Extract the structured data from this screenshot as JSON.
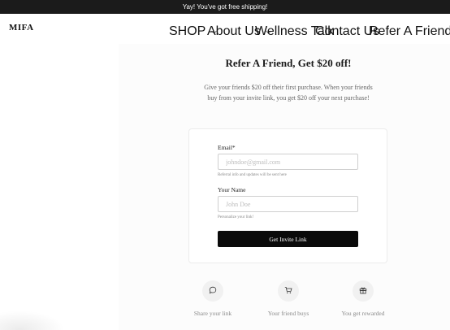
{
  "announcement": "Yay! You've got free shipping!",
  "brand": {
    "logo": "MIFA"
  },
  "nav": [
    {
      "label": "SHOP",
      "has_dropdown": true
    },
    {
      "label": "About Us",
      "has_dropdown": true
    },
    {
      "label": "Wellness Talk",
      "has_dropdown": false
    },
    {
      "label": "Contact Us",
      "has_dropdown": false
    },
    {
      "label": "Refer A Friend",
      "has_dropdown": false
    }
  ],
  "referral": {
    "title": "Refer A Friend, Get $20 off!",
    "subtitle": "Give your friends $20 off their first purchase. When your friends buy from your invite link, you get $20 off your next purchase!",
    "email_label": "Email*",
    "email_placeholder": "johndoe@gmail.com",
    "email_value": "",
    "email_hint": "Referral info and updates will be sent here",
    "name_label": "Your Name",
    "name_placeholder": "John Doe",
    "name_value": "",
    "name_hint": "Personalize your link!",
    "button_label": "Get Invite Link"
  },
  "steps": [
    {
      "label": "Share your link",
      "icon": "chat-bubble-icon"
    },
    {
      "label": "Your friend buys",
      "icon": "cart-icon"
    },
    {
      "label": "You get rewarded",
      "icon": "gift-icon"
    }
  ],
  "colors": {
    "announcement_bg": "#1b1b1b",
    "button_bg": "#0a0a0a"
  }
}
